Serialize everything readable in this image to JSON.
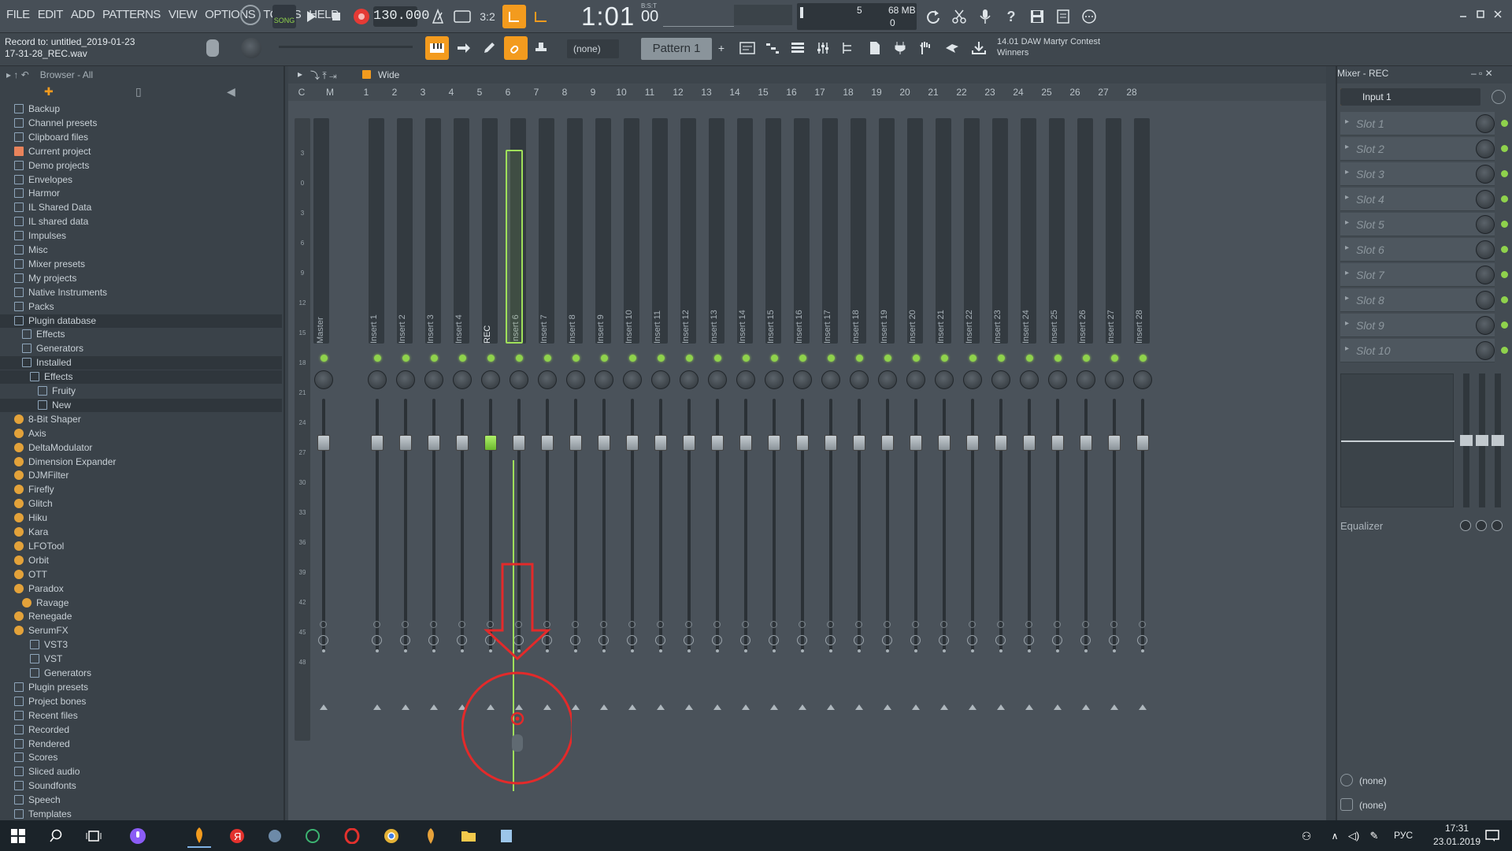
{
  "menu": [
    "FILE",
    "EDIT",
    "ADD",
    "PATTERNS",
    "VIEW",
    "OPTIONS",
    "TOOLS",
    "HELP"
  ],
  "song_mode_label": "SONG",
  "tempo": "130.000",
  "time": {
    "main": "1:01",
    "sub": "00",
    "label": "B:S:T"
  },
  "cpu": "5",
  "memory": "68 MB",
  "polyphony": "0",
  "record_hint": {
    "line1": "Record to: untitled_2019-01-23",
    "line2": "17-31-28_REC.wav"
  },
  "snap_select": "(none)",
  "pattern": "Pattern 1",
  "news": {
    "line1": "14.01  DAW Martyr Contest",
    "line2": "Winners"
  },
  "browser": {
    "header": "Browser - All",
    "items": [
      {
        "label": "Backup",
        "indent": 0,
        "sel": false
      },
      {
        "label": "Channel presets",
        "indent": 0,
        "sel": false
      },
      {
        "label": "Clipboard files",
        "indent": 0,
        "sel": false
      },
      {
        "label": "Current project",
        "indent": 0,
        "sel": false
      },
      {
        "label": "Demo projects",
        "indent": 0,
        "sel": false
      },
      {
        "label": "Envelopes",
        "indent": 0,
        "sel": false
      },
      {
        "label": "Harmor",
        "indent": 0,
        "sel": false
      },
      {
        "label": "IL Shared Data",
        "indent": 0,
        "sel": false
      },
      {
        "label": "IL shared data",
        "indent": 0,
        "sel": false
      },
      {
        "label": "Impulses",
        "indent": 0,
        "sel": false
      },
      {
        "label": "Misc",
        "indent": 0,
        "sel": false
      },
      {
        "label": "Mixer presets",
        "indent": 0,
        "sel": false
      },
      {
        "label": "My projects",
        "indent": 0,
        "sel": false
      },
      {
        "label": "Native Instruments",
        "indent": 0,
        "sel": false
      },
      {
        "label": "Packs",
        "indent": 0,
        "sel": false
      },
      {
        "label": "Plugin database",
        "indent": 0,
        "sel": true
      },
      {
        "label": "Effects",
        "indent": 1,
        "sel": false
      },
      {
        "label": "Generators",
        "indent": 1,
        "sel": false
      },
      {
        "label": "Installed",
        "indent": 1,
        "sel": true
      },
      {
        "label": "Effects",
        "indent": 2,
        "sel": true
      },
      {
        "label": "Fruity",
        "indent": 3,
        "sel": false
      },
      {
        "label": "New",
        "indent": 3,
        "sel": true
      },
      {
        "label": "8-Bit Shaper",
        "indent": 0,
        "sel": false
      },
      {
        "label": "Axis",
        "indent": 0,
        "sel": false
      },
      {
        "label": "DeltaModulator",
        "indent": 0,
        "sel": false
      },
      {
        "label": "Dimension Expander",
        "indent": 0,
        "sel": false
      },
      {
        "label": "DJMFilter",
        "indent": 0,
        "sel": false
      },
      {
        "label": "Firefly",
        "indent": 0,
        "sel": false
      },
      {
        "label": "Glitch",
        "indent": 0,
        "sel": false
      },
      {
        "label": "Hiku",
        "indent": 0,
        "sel": false
      },
      {
        "label": "Kara",
        "indent": 0,
        "sel": false
      },
      {
        "label": "LFOTool",
        "indent": 0,
        "sel": false
      },
      {
        "label": "Orbit",
        "indent": 0,
        "sel": false
      },
      {
        "label": "OTT",
        "indent": 0,
        "sel": false
      },
      {
        "label": "Paradox",
        "indent": 0,
        "sel": false
      },
      {
        "label": "Ravage",
        "indent": 1,
        "sel": false
      },
      {
        "label": "Renegade",
        "indent": 0,
        "sel": false
      },
      {
        "label": "SerumFX",
        "indent": 0,
        "sel": false
      },
      {
        "label": "VST3",
        "indent": 2,
        "sel": false
      },
      {
        "label": "VST",
        "indent": 2,
        "sel": false
      },
      {
        "label": "Generators",
        "indent": 2,
        "sel": false
      },
      {
        "label": "Plugin presets",
        "indent": 0,
        "sel": false
      },
      {
        "label": "Project bones",
        "indent": 0,
        "sel": false
      },
      {
        "label": "Recent files",
        "indent": 0,
        "sel": false
      },
      {
        "label": "Recorded",
        "indent": 0,
        "sel": false
      },
      {
        "label": "Rendered",
        "indent": 0,
        "sel": false
      },
      {
        "label": "Scores",
        "indent": 0,
        "sel": false
      },
      {
        "label": "Sliced audio",
        "indent": 0,
        "sel": false
      },
      {
        "label": "Soundfonts",
        "indent": 0,
        "sel": false
      },
      {
        "label": "Speech",
        "indent": 0,
        "sel": false
      },
      {
        "label": "Templates",
        "indent": 0,
        "sel": false
      }
    ]
  },
  "mixer": {
    "view_label": "Wide",
    "ruler_left": [
      "C",
      "M"
    ],
    "ruler": [
      "1",
      "2",
      "3",
      "4",
      "5",
      "6",
      "7",
      "8",
      "9",
      "10",
      "11",
      "12",
      "13",
      "14",
      "15",
      "16",
      "17",
      "18",
      "19",
      "20",
      "21",
      "22",
      "23",
      "24",
      "25",
      "26",
      "27",
      "28"
    ],
    "db_scale": [
      "3",
      "0",
      "3",
      "6",
      "9",
      "12",
      "15",
      "18",
      "21",
      "24",
      "27",
      "30",
      "33",
      "36",
      "39",
      "42",
      "45",
      "48"
    ],
    "tracks": [
      "Master",
      "Insert 1",
      "Insert 2",
      "Insert 3",
      "Insert 4",
      "REC",
      "Insert 6",
      "Insert 7",
      "Insert 8",
      "Insert 9",
      "Insert 10",
      "Insert 11",
      "Insert 12",
      "Insert 13",
      "Insert 14",
      "Insert 15",
      "Insert 16",
      "Insert 17",
      "Insert 18",
      "Insert 19",
      "Insert 20",
      "Insert 21",
      "Insert 22",
      "Insert 23",
      "Insert 24",
      "Insert 25",
      "Insert 26",
      "Insert 27",
      "Insert 28"
    ],
    "selected_track": "REC"
  },
  "panel": {
    "title": "Mixer - REC",
    "input": "Input 1",
    "slots": [
      "Slot 1",
      "Slot 2",
      "Slot 3",
      "Slot 4",
      "Slot 5",
      "Slot 6",
      "Slot 7",
      "Slot 8",
      "Slot 9",
      "Slot 10"
    ],
    "eq_label": "Equalizer",
    "out1": "(none)",
    "out2": "(none)"
  },
  "taskbar": {
    "lang": "РУС",
    "time": "17:31",
    "date": "23.01.2019"
  },
  "colors": {
    "accent_green": "#8fd24c",
    "annotation_red": "#e32a2a",
    "selected_track": "#9fe05a"
  }
}
